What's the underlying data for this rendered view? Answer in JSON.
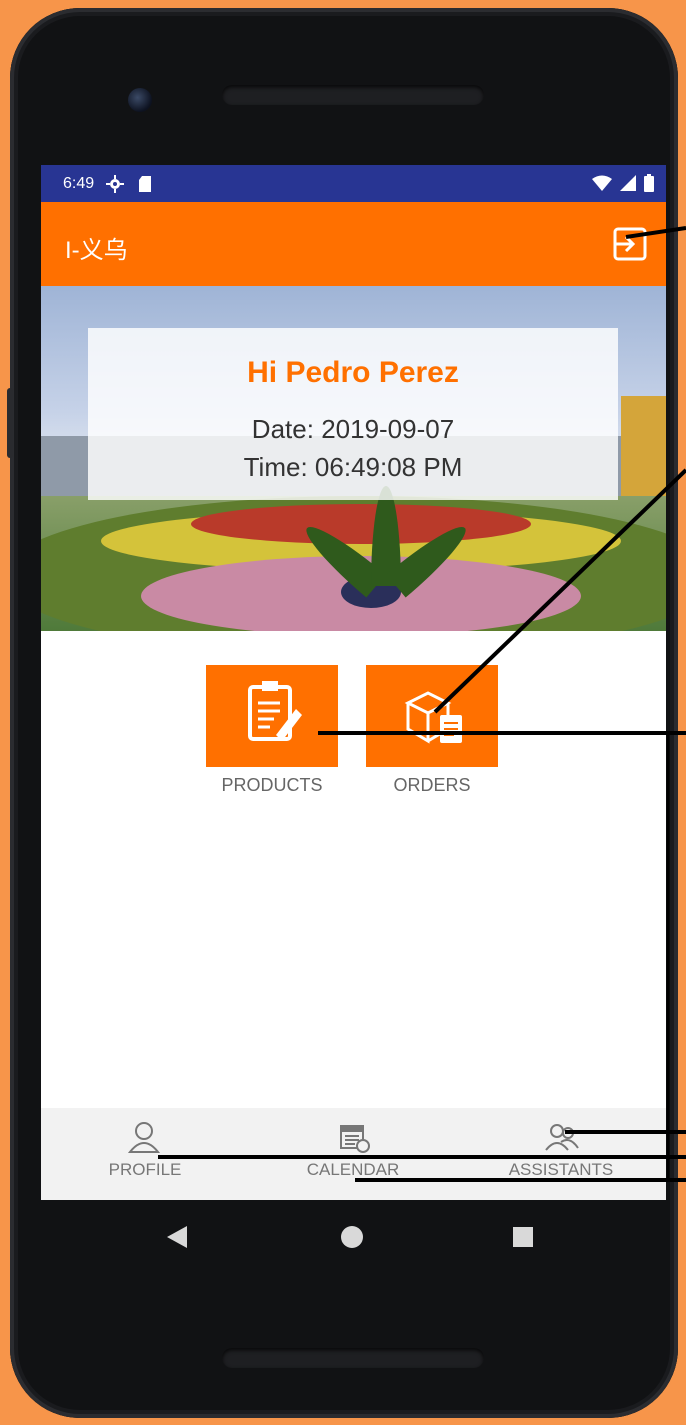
{
  "status_bar": {
    "time": "6:49"
  },
  "app_bar": {
    "title": "I-义乌"
  },
  "greeting": {
    "hi": "Hi Pedro Perez",
    "date_label": "Date:",
    "date_value": "2019-09-07",
    "time_label": "Time:",
    "time_value": "06:49:08 PM"
  },
  "menu": [
    {
      "label": "PRODUCTS",
      "icon": "clipboard-edit-icon"
    },
    {
      "label": "ORDERS",
      "icon": "box-order-icon"
    }
  ],
  "bottom_nav": [
    {
      "label": "PROFILE",
      "icon": "person-icon"
    },
    {
      "label": "CALENDAR",
      "icon": "calendar-icon"
    },
    {
      "label": "ASSISTANTS",
      "icon": "group-icon"
    }
  ],
  "colors": {
    "primary": "#ff7000",
    "status_bar": "#283593",
    "background": "#f7954a"
  }
}
